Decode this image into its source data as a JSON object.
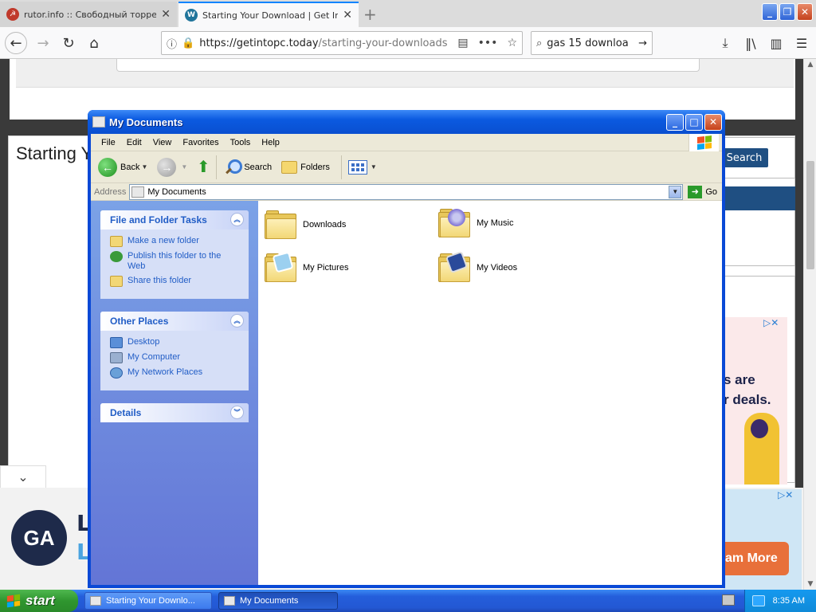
{
  "browser": {
    "tabs": [
      {
        "title": "rutor.info :: Свободный торрен",
        "active": false
      },
      {
        "title": "Starting Your Download | Get Into",
        "active": true
      }
    ],
    "url_main": "https://getintopc.today",
    "url_path": "/starting-your-downloads",
    "search_text": "gas 15 downloa"
  },
  "webpage": {
    "title": "Starting Y",
    "search_button": "Search",
    "ad_text_line1": "s are",
    "ad_text_line2": "r deals.",
    "ga_logo": "GA",
    "ga_letter1": "L",
    "ga_letter2": "L",
    "ad_button": "am More"
  },
  "explorer": {
    "title": "My Documents",
    "menu": [
      "File",
      "Edit",
      "View",
      "Favorites",
      "Tools",
      "Help"
    ],
    "toolbar": {
      "back": "Back",
      "search": "Search",
      "folders": "Folders"
    },
    "address_label": "Address",
    "address_value": "My Documents",
    "go_label": "Go",
    "panels": {
      "tasks": {
        "header": "File and Folder Tasks",
        "items": [
          "Make a new folder",
          "Publish this folder to the Web",
          "Share this folder"
        ]
      },
      "places": {
        "header": "Other Places",
        "items": [
          "Desktop",
          "My Computer",
          "My Network Places"
        ]
      },
      "details": {
        "header": "Details"
      }
    },
    "items": [
      {
        "name": "Downloads",
        "icon": "folder-icon"
      },
      {
        "name": "My Music",
        "icon": "music-folder-icon"
      },
      {
        "name": "My Pictures",
        "icon": "pictures-folder-icon"
      },
      {
        "name": "My Videos",
        "icon": "videos-folder-icon"
      }
    ]
  },
  "taskbar": {
    "start_label": "start",
    "buttons": [
      {
        "label": "Starting Your Downlo...",
        "active": false
      },
      {
        "label": "My Documents",
        "active": true
      }
    ],
    "clock": "8:35 AM"
  },
  "colors": {
    "xp_blue": "#0a49d6",
    "task_panel_link": "#215dc6",
    "firefox_accent": "#0a84ff"
  }
}
